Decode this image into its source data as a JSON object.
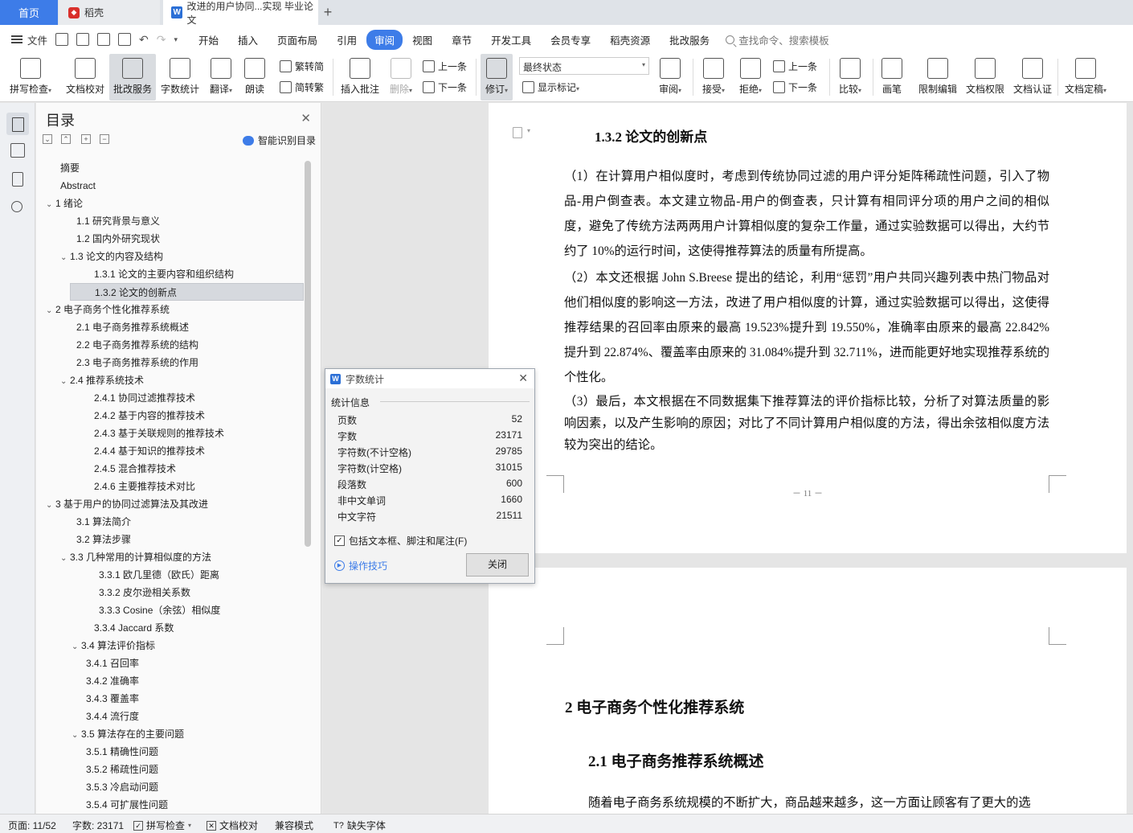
{
  "tabs": {
    "home": "首页",
    "daoke": "稻壳",
    "doc": "改进的用户协同...实现 毕业论文",
    "add": "+"
  },
  "menu": {
    "file": "文件",
    "items": [
      "开始",
      "插入",
      "页面布局",
      "引用",
      "审阅",
      "视图",
      "章节",
      "开发工具",
      "会员专享",
      "稻壳资源",
      "批改服务"
    ],
    "active": "审阅",
    "search": "查找命令、搜索模板"
  },
  "ribbon": {
    "spell": "拼写检查",
    "proof": "文档校对",
    "revise_service": "批改服务",
    "word_count": "字数统计",
    "translate": "翻译",
    "read": "朗读",
    "to_trad": "繁转简",
    "to_simp": "简转繁",
    "insert_comment": "插入批注",
    "delete": "删除",
    "prev": "上一条",
    "next": "下一条",
    "track": "修订",
    "status_value": "最终状态",
    "show_marks": "显示标记",
    "review": "审阅",
    "accept": "接受",
    "reject": "拒绝",
    "prev2": "上一条",
    "next2": "下一条",
    "compare": "比较",
    "pen": "画笔",
    "restrict": "限制编辑",
    "permission": "文档权限",
    "certify": "文档认证",
    "finalize": "文档定稿"
  },
  "nav": {
    "title": "目录",
    "smart": "智能识别目录",
    "items": [
      {
        "label": "摘要",
        "chev": ""
      },
      {
        "label": "Abstract",
        "chev": ""
      },
      {
        "label": "1  绪论",
        "chev": "⌄"
      },
      {
        "label": "1.1 研究背景与意义",
        "chev": ""
      },
      {
        "label": "1.2 国内外研究现状",
        "chev": ""
      },
      {
        "label": "1.3 论文的内容及结构",
        "chev": "⌄"
      },
      {
        "label": "1.3.1 论文的主要内容和组织结构",
        "chev": ""
      },
      {
        "label": "1.3.2 论文的创新点",
        "chev": ""
      },
      {
        "label": "2  电子商务个性化推荐系统",
        "chev": "⌄"
      },
      {
        "label": "2.1 电子商务推荐系统概述",
        "chev": ""
      },
      {
        "label": "2.2 电子商务推荐系统的结构",
        "chev": ""
      },
      {
        "label": "2.3 电子商务推荐系统的作用",
        "chev": ""
      },
      {
        "label": "2.4 推荐系统技术",
        "chev": "⌄"
      },
      {
        "label": "2.4.1 协同过滤推荐技术",
        "chev": ""
      },
      {
        "label": "2.4.2 基于内容的推荐技术",
        "chev": ""
      },
      {
        "label": "2.4.3 基于关联规则的推荐技术",
        "chev": ""
      },
      {
        "label": "2.4.4 基于知识的推荐技术",
        "chev": ""
      },
      {
        "label": "2.4.5 混合推荐技术",
        "chev": ""
      },
      {
        "label": "2.4.6 主要推荐技术对比",
        "chev": ""
      },
      {
        "label": "3  基于用户的协同过滤算法及其改进",
        "chev": "⌄"
      },
      {
        "label": "3.1 算法简介",
        "chev": ""
      },
      {
        "label": "3.2 算法步骤",
        "chev": ""
      },
      {
        "label": "3.3 几种常用的计算相似度的方法",
        "chev": "⌄"
      },
      {
        "label": "3.3.1 欧几里德（欧氏）距离",
        "chev": ""
      },
      {
        "label": "3.3.2 皮尔逊相关系数",
        "chev": ""
      },
      {
        "label": "3.3.3 Cosine（余弦）相似度",
        "chev": ""
      },
      {
        "label": "3.3.4 Jaccard  系数",
        "chev": ""
      },
      {
        "label": "3.4 算法评价指标",
        "chev": "⌄"
      },
      {
        "label": "3.4.1 召回率",
        "chev": ""
      },
      {
        "label": "3.4.2 准确率",
        "chev": ""
      },
      {
        "label": "3.4.3 覆盖率",
        "chev": ""
      },
      {
        "label": "3.4.4 流行度",
        "chev": ""
      },
      {
        "label": "3.5 算法存在的主要问题",
        "chev": "⌄"
      },
      {
        "label": "3.5.1 精确性问题",
        "chev": ""
      },
      {
        "label": "3.5.2 稀疏性问题",
        "chev": ""
      },
      {
        "label": "3.5.3 冷启动问题",
        "chev": ""
      },
      {
        "label": "3.5.4 可扩展性问题",
        "chev": ""
      }
    ]
  },
  "doc": {
    "h132": "1.3.2 论文的创新点",
    "p1": "（1）在计算用户相似度时，考虑到传统协同过滤的用户评分矩阵稀疏性问题，引入了物品-用户倒查表。本文建立物品-用户的倒查表，只计算有相同评分项的用户之间的相似度，避免了传统方法两两用户计算相似度的复杂工作量，通过实验数据可以得出，大约节约了 10%的运行时间，这使得推荐算法的质量有所提高。",
    "p2": "（2）本文还根据 John S.Breese 提出的结论，利用“惩罚”用户共同兴趣列表中热门物品对他们相似度的影响这一方法，改进了用户相似度的计算，通过实验数据可以得出，这使得推荐结果的召回率由原来的最高 19.523%提升到 19.550%，准确率由原来的最高 22.842%提升到 22.874%、覆盖率由原来的 31.084%提升到 32.711%，进而能更好地实现推荐系统的个性化。",
    "p3": "（3）最后，本文根据在不同数据集下推荐算法的评价指标比较，分析了对算法质量的影响因素，以及产生影响的原因；对比了不同计算用户相似度的方法，得出余弦相似度方法较为突出的结论。",
    "pagenum": "－ 11 －",
    "h2": "2  电子商务个性化推荐系统",
    "h21": "2.1 电子商务推荐系统概述",
    "p4": "随着电子商务系统规模的不断扩大，商品越来越多，这一方面让顾客有了更大的选"
  },
  "dialog": {
    "title": "字数统计",
    "section": "统计信息",
    "rows": [
      {
        "label": "页数",
        "value": "52"
      },
      {
        "label": "字数",
        "value": "23171"
      },
      {
        "label": "字符数(不计空格)",
        "value": "29785"
      },
      {
        "label": "字符数(计空格)",
        "value": "31015"
      },
      {
        "label": "段落数",
        "value": "600"
      },
      {
        "label": "非中文单词",
        "value": "1660"
      },
      {
        "label": "中文字符",
        "value": "21511"
      }
    ],
    "checkbox": "包括文本框、脚注和尾注(F)",
    "checked": true,
    "tips": "操作技巧",
    "close": "关闭"
  },
  "status": {
    "page": "页面: 11/52",
    "words": "字数: 23171",
    "spell": "拼写检查",
    "proof": "文档校对",
    "compat": "兼容模式",
    "missing_font": "缺失字体"
  },
  "colors": {
    "accent": "#3d7ce8"
  }
}
